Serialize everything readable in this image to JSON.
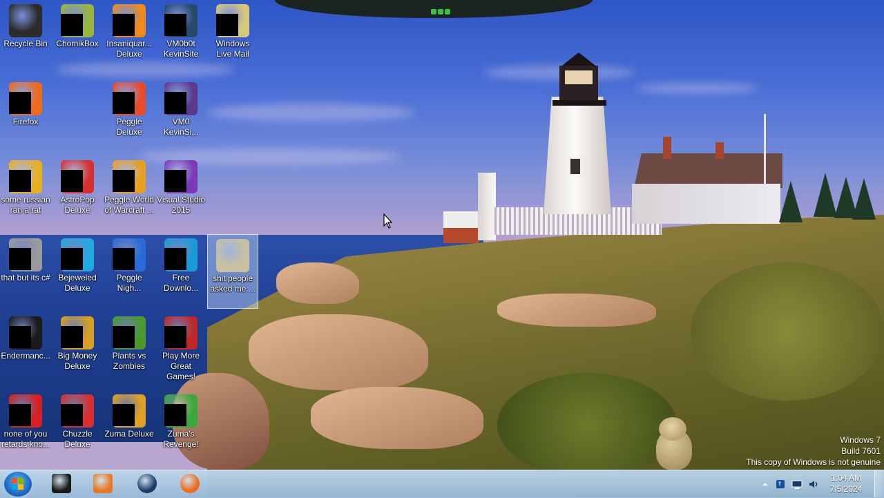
{
  "desktop": {
    "icons": [
      {
        "label": "Recycle Bin",
        "icon": "recycle-bin-icon",
        "color": "#2b2b2b",
        "masked": false
      },
      {
        "label": "ChomikBox",
        "icon": "chomikbox-icon",
        "color": "#9bb53a",
        "masked": true
      },
      {
        "label": "Insaniquar... Deluxe",
        "icon": "insaniquarium-icon",
        "color": "#f08a1a",
        "masked": true
      },
      {
        "label": "VM0b0t KevinSite",
        "icon": "vm0b0t-icon",
        "color": "#274a6a",
        "masked": true
      },
      {
        "label": "Windows Live Mail",
        "icon": "windows-live-mail-icon",
        "color": "#d8c878",
        "masked": true
      },
      {
        "label": "Firefox",
        "icon": "firefox-icon",
        "color": "#f06a1a",
        "masked": true
      },
      {
        "label": "Peggle Deluxe",
        "icon": "peggle-icon",
        "color": "#e94a2a",
        "masked": true
      },
      {
        "label": "VM0 KevinSi...",
        "icon": "vm0-icon",
        "color": "#5a3a8a",
        "masked": true
      },
      {
        "label": "some russian ran a rat",
        "icon": "document-icon",
        "color": "#e8b020",
        "masked": true
      },
      {
        "label": "AstroPop Deluxe",
        "icon": "astropop-icon",
        "color": "#d83030",
        "masked": true
      },
      {
        "label": "Peggle World of Warcraft ...",
        "icon": "peggle-wow-icon",
        "color": "#e8a020",
        "masked": true
      },
      {
        "label": "Visual Studio 2015",
        "icon": "visual-studio-icon",
        "color": "#7a3ab8",
        "masked": true
      },
      {
        "label": "that but its c#",
        "icon": "stacked-files-icon",
        "color": "#9a9a9a",
        "masked": true
      },
      {
        "label": "Bejeweled Deluxe",
        "icon": "bejeweled-icon",
        "color": "#20a8e0",
        "masked": true
      },
      {
        "label": "Peggle Nigh...",
        "icon": "peggle-nights-icon",
        "color": "#2a6ad8",
        "masked": true
      },
      {
        "label": "Free Downlo...",
        "icon": "free-download-icon",
        "color": "#1a9ad8",
        "masked": true
      },
      {
        "label": "shit people asked me ...",
        "icon": "folder-icon",
        "color": "#c8c0a0",
        "masked": false,
        "selected": true
      },
      {
        "label": "Endermanc...",
        "icon": "terminal-icon",
        "color": "#1a1a1a",
        "masked": true
      },
      {
        "label": "Big Money Deluxe",
        "icon": "big-money-icon",
        "color": "#d8a020",
        "masked": true
      },
      {
        "label": "Plants vs Zombies",
        "icon": "plants-vs-zombies-icon",
        "color": "#4a9a2a",
        "masked": true
      },
      {
        "label": "Play More Great Games!",
        "icon": "popcap-icon",
        "color": "#c02828",
        "masked": true
      },
      {
        "label": "none of you retards kno...",
        "icon": "opera-icon",
        "color": "#d82020",
        "masked": true
      },
      {
        "label": "Chuzzle Deluxe",
        "icon": "chuzzle-icon",
        "color": "#d83030",
        "masked": true
      },
      {
        "label": "Zuma Deluxe",
        "icon": "zuma-icon",
        "color": "#e0a020",
        "masked": true
      },
      {
        "label": "Zuma's Revenge!",
        "icon": "zumas-revenge-icon",
        "color": "#3aa83a",
        "masked": true
      }
    ]
  },
  "watermark": {
    "line1": "Windows 7",
    "line2": "Build 7601",
    "line3": "This copy of Windows is not genuine"
  },
  "taskbar": {
    "start": "start-orb-icon",
    "pinned": [
      {
        "icon": "terminal-app-icon",
        "color": "#1a1a1a"
      },
      {
        "icon": "media-player-icon",
        "color": "#e87820"
      },
      {
        "icon": "globe-icon",
        "color": "#1a3a6a"
      },
      {
        "icon": "firefox-taskbar-icon",
        "color": "#f06a1a"
      }
    ],
    "tray": [
      "show-hidden-icons-icon",
      "network-app-icon",
      "monitor-icon",
      "volume-icon"
    ],
    "clock": {
      "time": "1:04 AM",
      "date": "7/5/2024"
    }
  },
  "colors": {
    "accent": "#2a7bd5",
    "taskbar": "#a6c6e2"
  }
}
